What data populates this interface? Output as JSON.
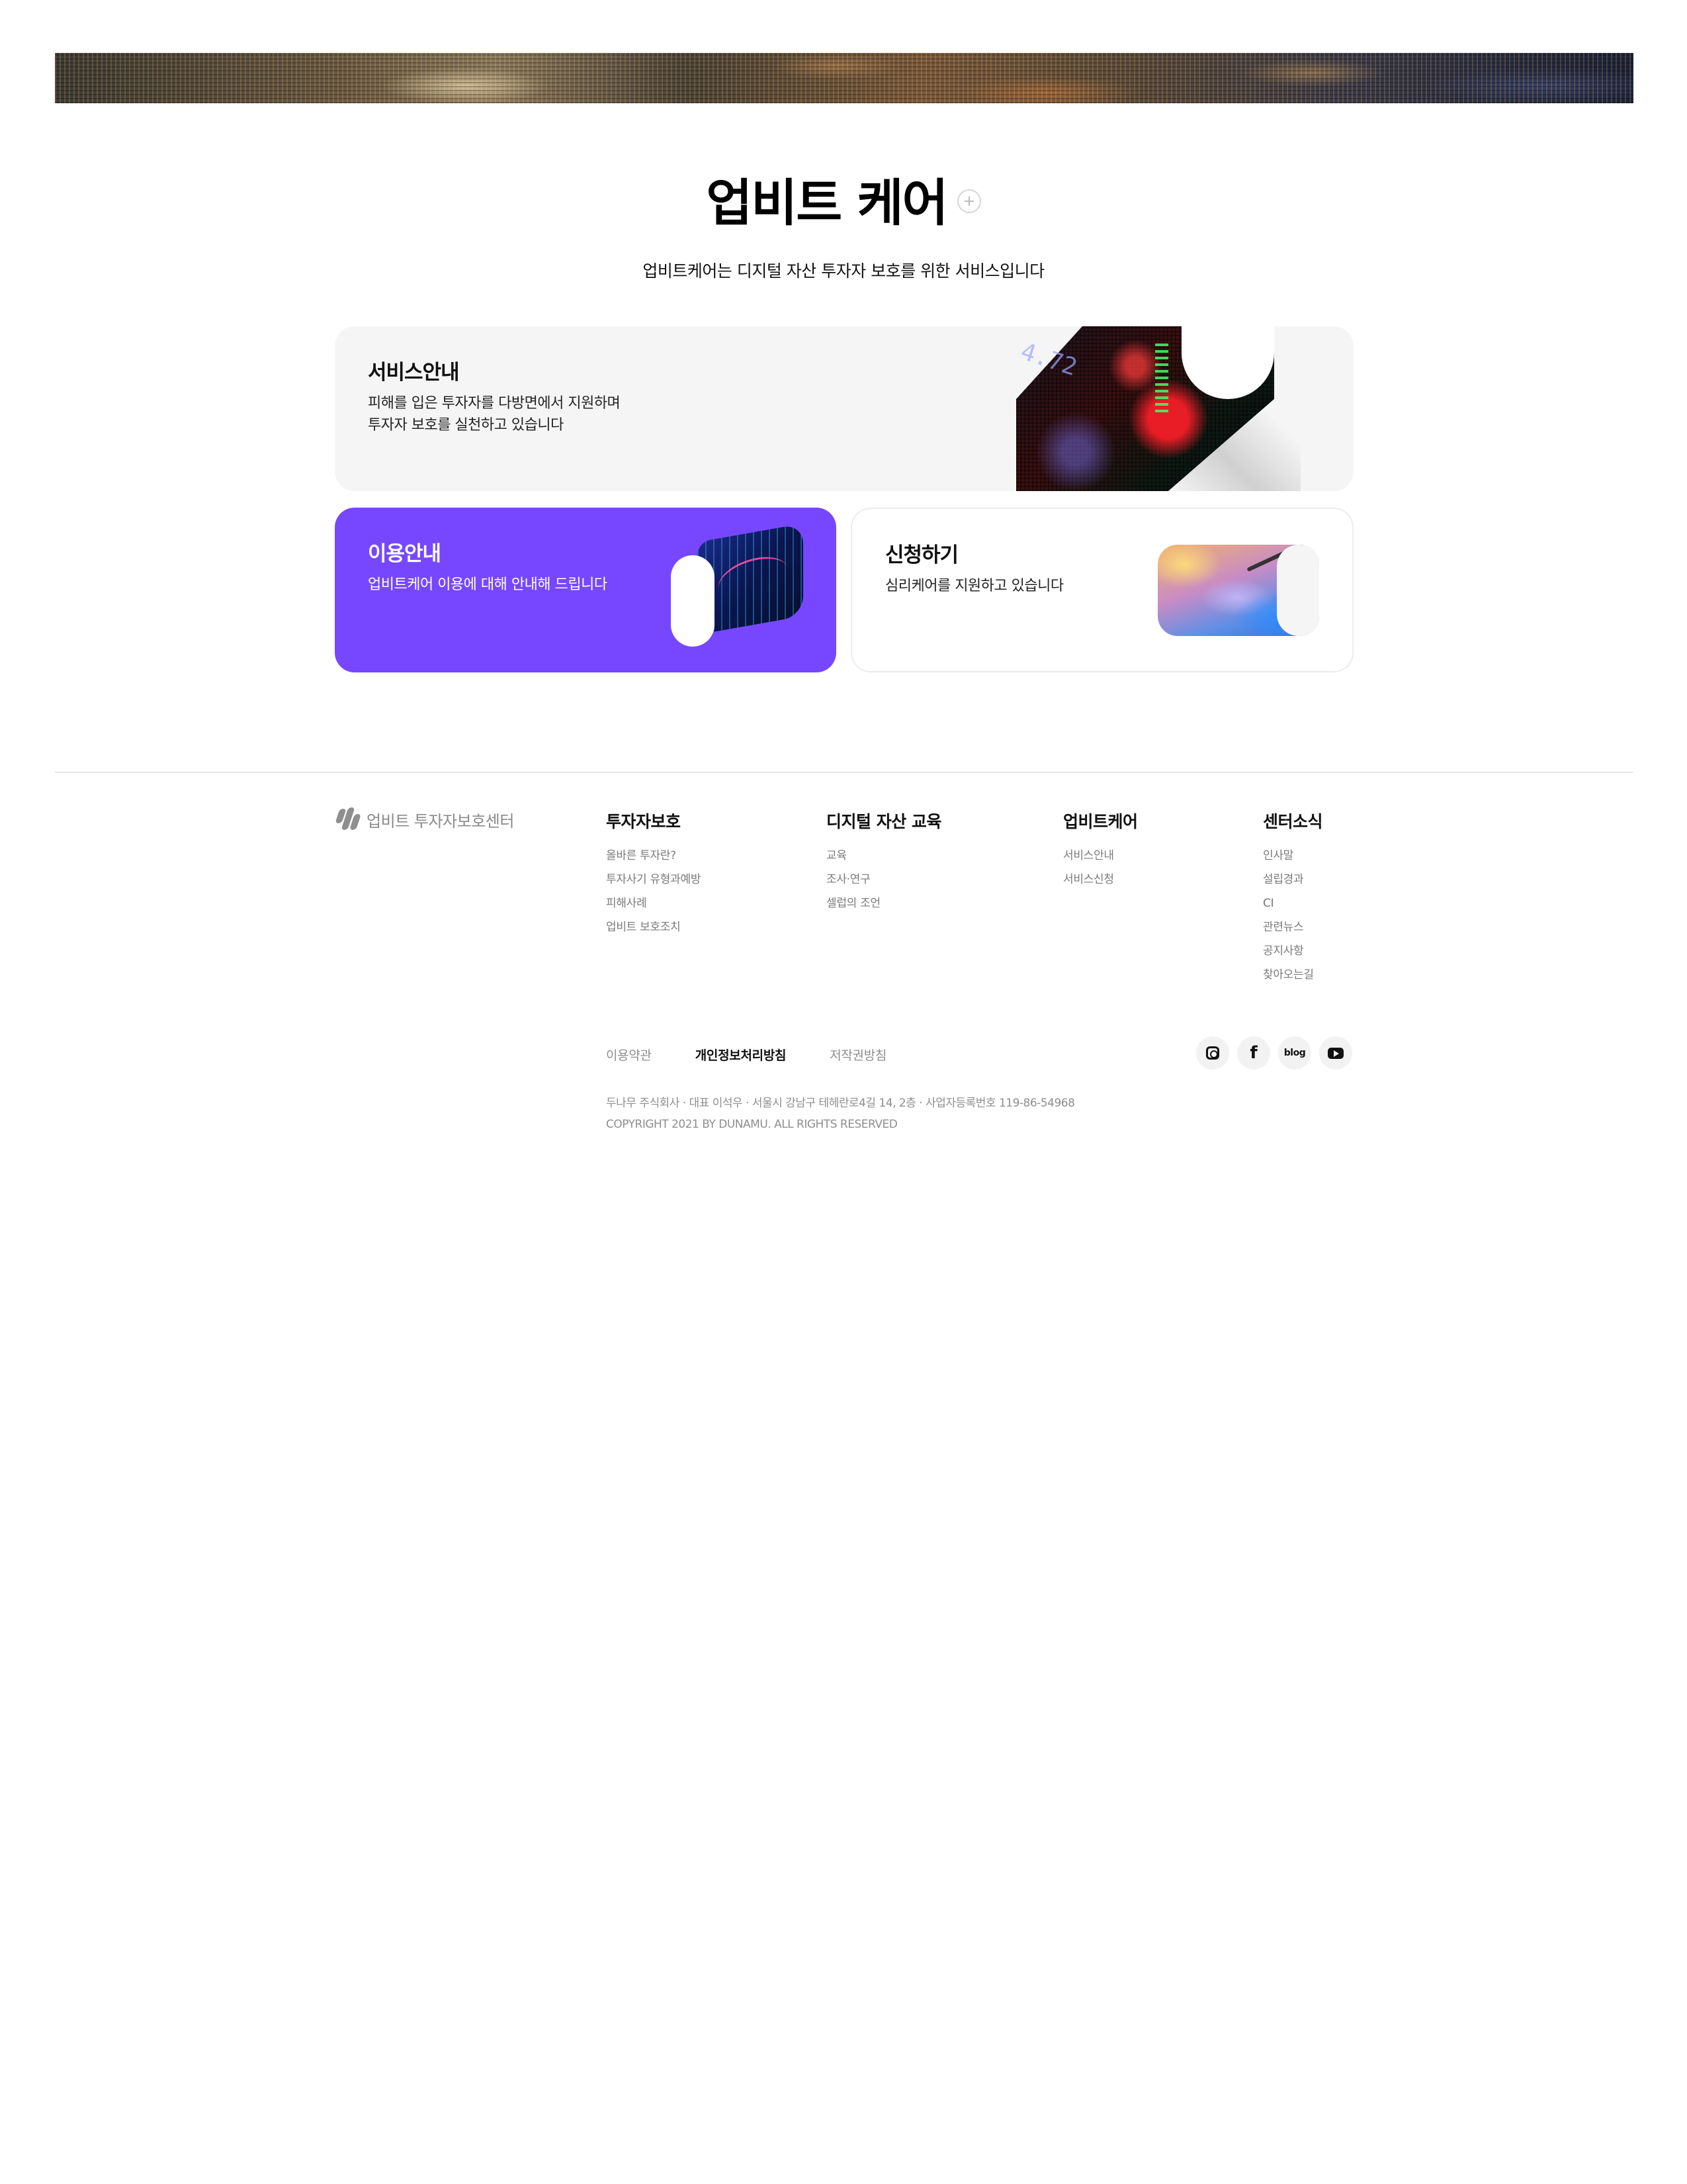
{
  "page": {
    "title": "업비트 케어",
    "subtitle": "업비트케어는 디지털 자산 투자자 보호를 위한 서비스입니다"
  },
  "cards": {
    "service": {
      "title": "서비스안내",
      "description": "피해를 입은 투자자를 다방면에서 지원하며\n투자자 보호를 실천하고 있습니다",
      "art_text": "4.72"
    },
    "guide": {
      "title": "이용안내",
      "description": "업비트케어 이용에 대해 안내해 드립니다",
      "background_color": "#7747ff"
    },
    "apply": {
      "title": "신청하기",
      "description": "심리케어를 지원하고 있습니다"
    }
  },
  "footer": {
    "logo_text": "업비트 투자자보호센터",
    "columns": [
      {
        "title": "투자자보호",
        "links": [
          "올바른 투자란?",
          "투자사기 유형과예방",
          "피해사례",
          "업비트 보호조치"
        ]
      },
      {
        "title": "디지털 자산 교육",
        "links": [
          "교육",
          "조사·연구",
          "셀럽의 조언"
        ]
      },
      {
        "title": "업비트케어",
        "links": [
          "서비스안내",
          "서비스신청"
        ]
      },
      {
        "title": "센터소식",
        "links": [
          "인사말",
          "설립경과",
          "CI",
          "관련뉴스",
          "공지사항",
          "찾아오는길"
        ]
      }
    ],
    "legal_links": [
      "이용약관",
      "개인정보처리방침",
      "저작권방침"
    ],
    "social": {
      "instagram": "instagram-icon",
      "facebook_glyph": "f",
      "blog_label": "blog",
      "youtube": "youtube-icon"
    },
    "company_info": "두나무 주식회사 · 대표 이석우 · 서울시 강남구 테헤란로4길 14, 2층 · 사업자등록번호 119-86-54968",
    "copyright": "COPYRIGHT 2021 BY DUNAMU. ALL RIGHTS RESERVED"
  }
}
